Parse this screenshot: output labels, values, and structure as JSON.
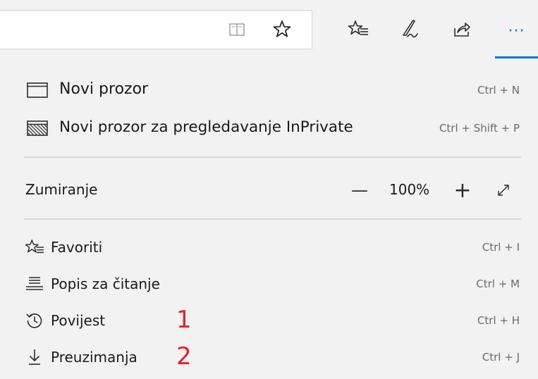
{
  "toolbar": {
    "icons": [
      "reading-view-icon",
      "favorite-star-icon",
      "favorites-hub-icon",
      "web-notes-pen-icon",
      "share-icon",
      "more-actions-icon"
    ],
    "more_label": "···",
    "accent_color": "#0078d7"
  },
  "menu": {
    "new_window": {
      "label": "Novi prozor",
      "shortcut": "Ctrl + N"
    },
    "new_inprivate": {
      "label": "Novi prozor za pregledavanje InPrivate",
      "shortcut": "Ctrl + Shift + P"
    },
    "zoom": {
      "label": "Zumiranje",
      "minus": "—",
      "value": "100%",
      "plus": "+"
    },
    "items": [
      {
        "label": "Favoriti",
        "shortcut": "Ctrl + I",
        "icon": "favorites-icon"
      },
      {
        "label": "Popis za čitanje",
        "shortcut": "Ctrl + M",
        "icon": "reading-list-icon"
      },
      {
        "label": "Povijest",
        "shortcut": "Ctrl + H",
        "icon": "history-icon",
        "annotation": "1"
      },
      {
        "label": "Preuzimanja",
        "shortcut": "Ctrl + J",
        "icon": "download-icon",
        "annotation": "2"
      }
    ],
    "annotation_color": "#e8202a"
  }
}
